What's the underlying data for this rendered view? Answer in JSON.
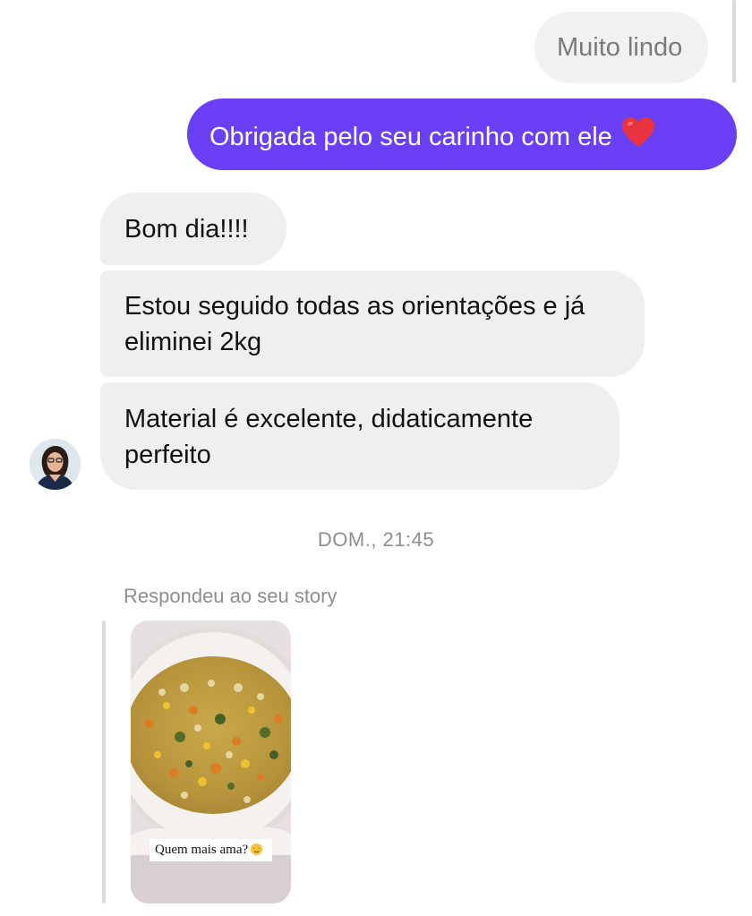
{
  "messages": {
    "quoted_reply": "Muito lindo",
    "sent": "Obrigada pelo seu carinho com ele",
    "received": [
      "Bom dia!!!!",
      "Estou seguido todas as orientações e já eliminei 2kg",
      "Material é excelente, didaticamente perfeito"
    ]
  },
  "timestamp": "DOM., 21:45",
  "story_reply": {
    "caption": "Respondeu ao seu story",
    "sticker_text": "Quem mais ama?"
  },
  "colors": {
    "sent_bubble": "#6a3ff5",
    "received_bubble": "#efefef",
    "meta_text": "#8e8e8e"
  },
  "icons": {
    "heart": "red-heart-emoji",
    "avatar": "user-avatar"
  }
}
